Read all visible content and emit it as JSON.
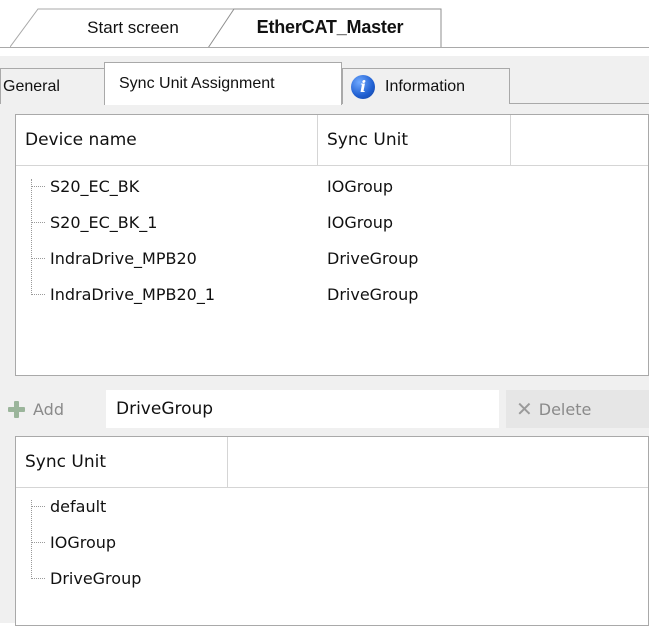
{
  "doc_tabs": [
    {
      "label": "Start screen"
    },
    {
      "label": "EtherCAT_Master"
    }
  ],
  "sub_tabs": [
    {
      "label": "General"
    },
    {
      "label": "Sync Unit Assignment"
    },
    {
      "label": "Information",
      "icon": "info-icon"
    }
  ],
  "device_table": {
    "columns": [
      "Device name",
      "Sync Unit"
    ],
    "rows": [
      {
        "name": "S20_EC_BK",
        "sync_unit": "IOGroup"
      },
      {
        "name": "S20_EC_BK_1",
        "sync_unit": "IOGroup"
      },
      {
        "name": "IndraDrive_MPB20",
        "sync_unit": "DriveGroup"
      },
      {
        "name": "IndraDrive_MPB20_1",
        "sync_unit": "DriveGroup"
      }
    ]
  },
  "toolbar": {
    "add_label": "Add",
    "input_value": "DriveGroup",
    "delete_label": "Delete"
  },
  "sync_unit_table": {
    "column": "Sync Unit",
    "items": [
      "default",
      "IOGroup",
      "DriveGroup"
    ]
  }
}
